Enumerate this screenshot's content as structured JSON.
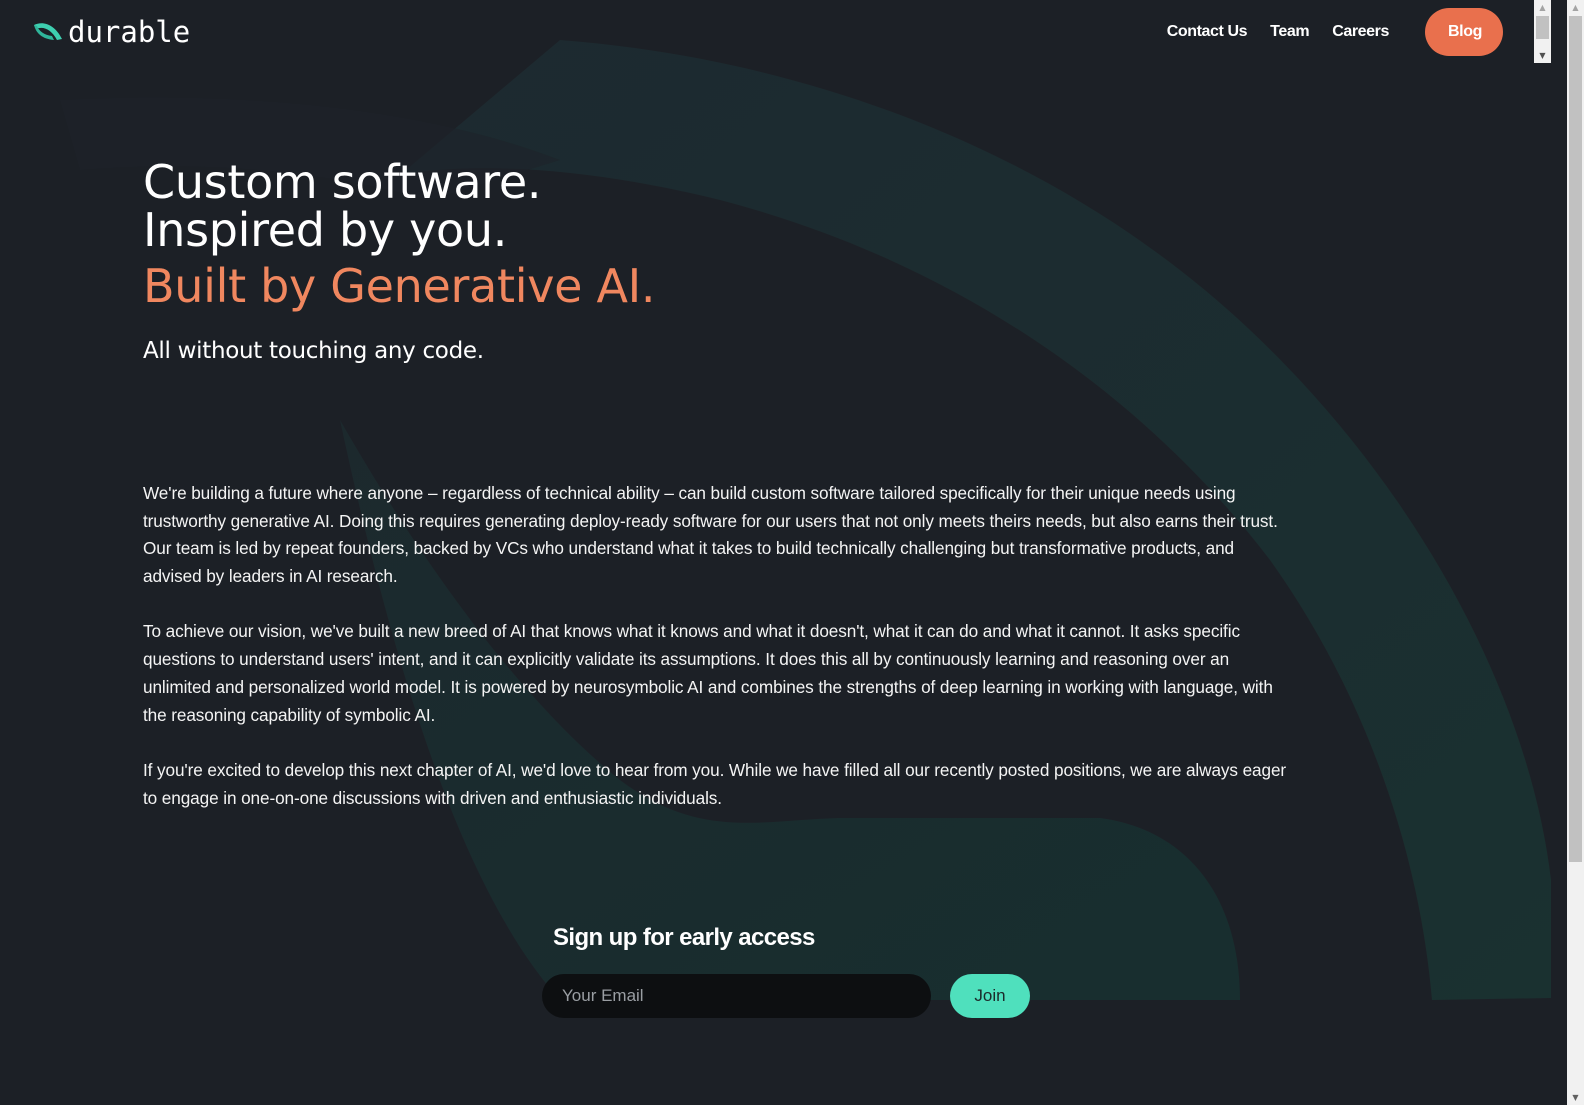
{
  "brand": {
    "name": "durable",
    "logo_icon": "leaf-arc-icon",
    "colors": {
      "background": "#1c2026",
      "accent_orange": "#f0875f",
      "blog_button": "#e9704d",
      "join_button": "#4fe0bd",
      "logo_teal": "#3ecfb0",
      "bg_arc": "#1a2f2f"
    }
  },
  "nav": {
    "items": [
      {
        "label": "Contact Us"
      },
      {
        "label": "Team"
      },
      {
        "label": "Careers"
      }
    ],
    "blog_label": "Blog"
  },
  "hero": {
    "line1": "Custom software.",
    "line2": "Inspired by you.",
    "line3": "Built by Generative AI.",
    "subtitle": "All without touching any code."
  },
  "body": {
    "paragraphs": [
      "We're building a future where anyone – regardless of technical ability – can build custom software tailored specifically for their unique needs using trustworthy generative AI. Doing this requires generating deploy-ready software for our users that not only meets theirs needs, but also earns their trust. Our team is led by repeat founders, backed by VCs who understand what it takes to build technically challenging but transformative products, and advised by leaders in AI research.",
      "To achieve our vision, we've built a new breed of AI that knows what it knows and what it doesn't, what it can do and what it cannot. It asks specific questions to understand users' intent, and it can explicitly validate its assumptions. It does this all by continuously learning and reasoning over an unlimited and personalized world model. It is powered by neurosymbolic AI and combines the strengths of deep learning in working with language, with the reasoning capability of symbolic AI.",
      "If you're excited to develop this next chapter of AI, we'd love to hear from you. While we have filled all our recently posted positions, we are always eager to engage in one-on-one discussions with driven and enthusiastic individuals."
    ]
  },
  "signup": {
    "title": "Sign up for early access",
    "email_value": "",
    "email_placeholder": "Your Email",
    "join_label": "Join"
  },
  "scrollbar": {
    "up_arrow": "▲",
    "down_arrow": "▼"
  }
}
